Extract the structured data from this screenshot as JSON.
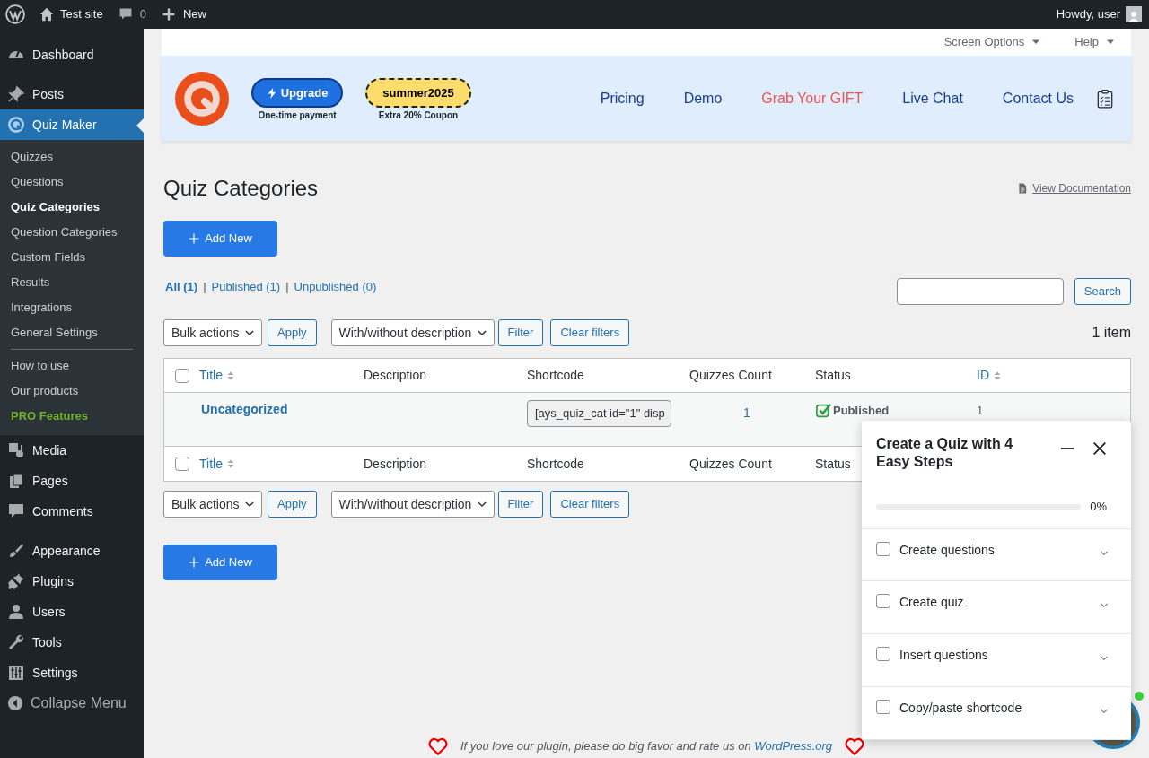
{
  "admin_bar": {
    "site": "Test site",
    "comments": "0",
    "new": "New",
    "greeting": "Howdy, user"
  },
  "sidebar": {
    "groups": [
      [
        {
          "label": "Dashboard",
          "selected": false
        }
      ],
      [
        {
          "label": "Posts",
          "selected": false
        },
        {
          "label": "Quiz Maker",
          "selected": true,
          "submenu": [
            [
              {
                "label": "Quizzes",
                "kind": "link",
                "selected": false
              },
              {
                "label": "Questions",
                "kind": "link",
                "selected": false
              },
              {
                "label": "Quiz Categories",
                "kind": "link",
                "selected": true
              },
              {
                "label": "Question Categories",
                "kind": "link",
                "selected": false
              },
              {
                "label": "Custom Fields",
                "kind": "link",
                "selected": false
              },
              {
                "label": "Results",
                "kind": "link",
                "selected": false
              },
              {
                "label": "Integrations",
                "kind": "link",
                "selected": false
              },
              {
                "label": "General Settings",
                "kind": "link",
                "selected": false
              }
            ],
            [
              {
                "label": "How to use",
                "kind": "link",
                "selected": false
              },
              {
                "label": "Our products",
                "kind": "link",
                "selected": false
              },
              {
                "label": "PRO Features",
                "kind": "pro",
                "selected": false
              }
            ]
          ]
        },
        {
          "label": "Media",
          "selected": false
        },
        {
          "label": "Pages",
          "selected": false
        },
        {
          "label": "Comments",
          "selected": false
        }
      ],
      [
        {
          "label": "Appearance",
          "selected": false
        },
        {
          "label": "Plugins",
          "selected": false
        },
        {
          "label": "Users",
          "selected": false
        },
        {
          "label": "Tools",
          "selected": false
        },
        {
          "label": "Settings",
          "selected": false
        }
      ]
    ],
    "collapse": "Collapse Menu"
  },
  "screen_tabs": [
    "Screen Options",
    "Help"
  ],
  "banner": {
    "upgrade": {
      "label": "Upgrade",
      "note": "One-time payment"
    },
    "coupon": {
      "code": "summer2025",
      "note": "Extra 20% Coupon"
    },
    "links": [
      {
        "label": "Pricing",
        "highlighted": false
      },
      {
        "label": "Demo",
        "highlighted": false
      },
      {
        "label": "Grab Your GIFT",
        "highlighted": true
      },
      {
        "label": "Live Chat",
        "highlighted": false
      },
      {
        "label": "Contact Us",
        "highlighted": false
      }
    ]
  },
  "page": {
    "title": "Quiz Categories",
    "doc_link": "View Documentation",
    "add_new": [
      "Add New",
      "Add New"
    ]
  },
  "views": [
    {
      "label": "All (1)",
      "selected": true
    },
    {
      "separator": "|",
      "label": "Published (1)",
      "selected": false
    },
    {
      "separator": "|",
      "label": "Unpublished (0)",
      "selected": false
    }
  ],
  "search_button": "Search",
  "toolbars": [
    {
      "bulk": "Bulk actions",
      "apply": "Apply",
      "filter_select": "With/without description",
      "filter": "Filter",
      "clear": "Clear filters",
      "count": "1 item"
    },
    {
      "bulk": "Bulk actions",
      "apply": "Apply",
      "filter_select": "With/without description",
      "filter": "Filter",
      "clear": "Clear filters"
    }
  ],
  "table": {
    "header_checkbox": {
      "checked": false
    },
    "footer_checkbox": {
      "checked": false
    },
    "columns": [
      {
        "label": "Title",
        "sortable": true
      },
      {
        "label": "Description",
        "sortable": false
      },
      {
        "label": "Shortcode",
        "sortable": false
      },
      {
        "label": "Quizzes Count",
        "sortable": false
      },
      {
        "label": "Status",
        "sortable": false
      },
      {
        "label": "ID",
        "sortable": true
      }
    ],
    "rows": [
      {
        "title": "Uncategorized",
        "description": "",
        "shortcode": "[ays_quiz_cat id=\"1\" disp",
        "count": "1",
        "status": "Published",
        "id": "1"
      }
    ],
    "footer_columns": [
      {
        "label": "Title",
        "sortable": true
      },
      {
        "label": "Description",
        "sortable": false
      },
      {
        "label": "Shortcode",
        "sortable": false
      },
      {
        "label": "Quizzes Count",
        "sortable": false
      },
      {
        "label": "Status",
        "sortable": false
      }
    ]
  },
  "footer_note": {
    "text": "If you love our plugin, please do big favor and rate us on",
    "link": "WordPress.org"
  },
  "steps_panel": {
    "title": "Create a Quiz with 4 Easy Steps",
    "progress": {
      "level": 0,
      "reading": "0%"
    },
    "steps": [
      {
        "label": "Create questions",
        "checked": false
      },
      {
        "label": "Create quiz",
        "checked": false
      },
      {
        "label": "Insert questions",
        "checked": false
      },
      {
        "label": "Copy/paste shortcode",
        "checked": false
      }
    ]
  }
}
